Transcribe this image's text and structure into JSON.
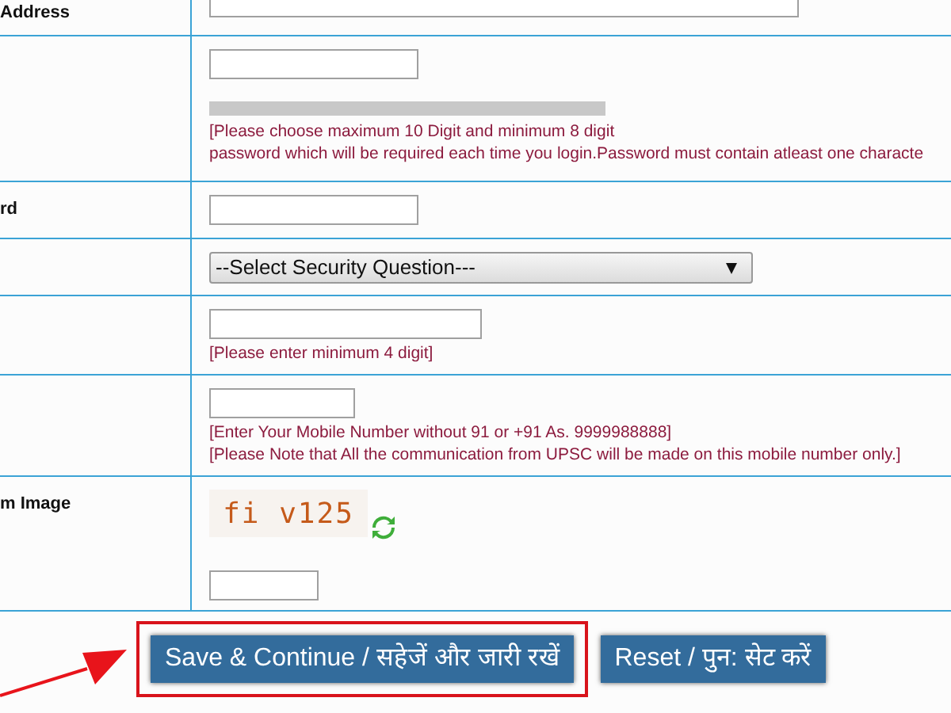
{
  "rows": [
    {
      "kind": "text",
      "label": "Address",
      "hints": []
    },
    {
      "kind": "password",
      "label": "",
      "hints": [
        "[Please choose maximum 10 Digit and minimum 8 digit",
        "password which will be required each time you login.Password must contain atleast one characte"
      ]
    },
    {
      "kind": "short",
      "label": "rd",
      "hints": []
    },
    {
      "kind": "select",
      "label": "",
      "value": "--Select Security Question---",
      "hints": []
    },
    {
      "kind": "medium",
      "label": "",
      "hints": [
        "[Please enter minimum 4 digit]"
      ]
    },
    {
      "kind": "mobile",
      "label": "",
      "hints": [
        "[Enter Your Mobile Number without 91 or +91 As. 9999988888]",
        "[Please Note that All the communication from UPSC will be made on this mobile number only.]"
      ]
    },
    {
      "kind": "captcha",
      "label": "m Image",
      "captcha": "fi v125",
      "hints": []
    }
  ],
  "buttons": [
    {
      "label": "Save & Continue / सहेजें और जारी रखें",
      "highlighted": true
    },
    {
      "label": "Reset / पुन: सेट करें",
      "highlighted": false
    }
  ]
}
